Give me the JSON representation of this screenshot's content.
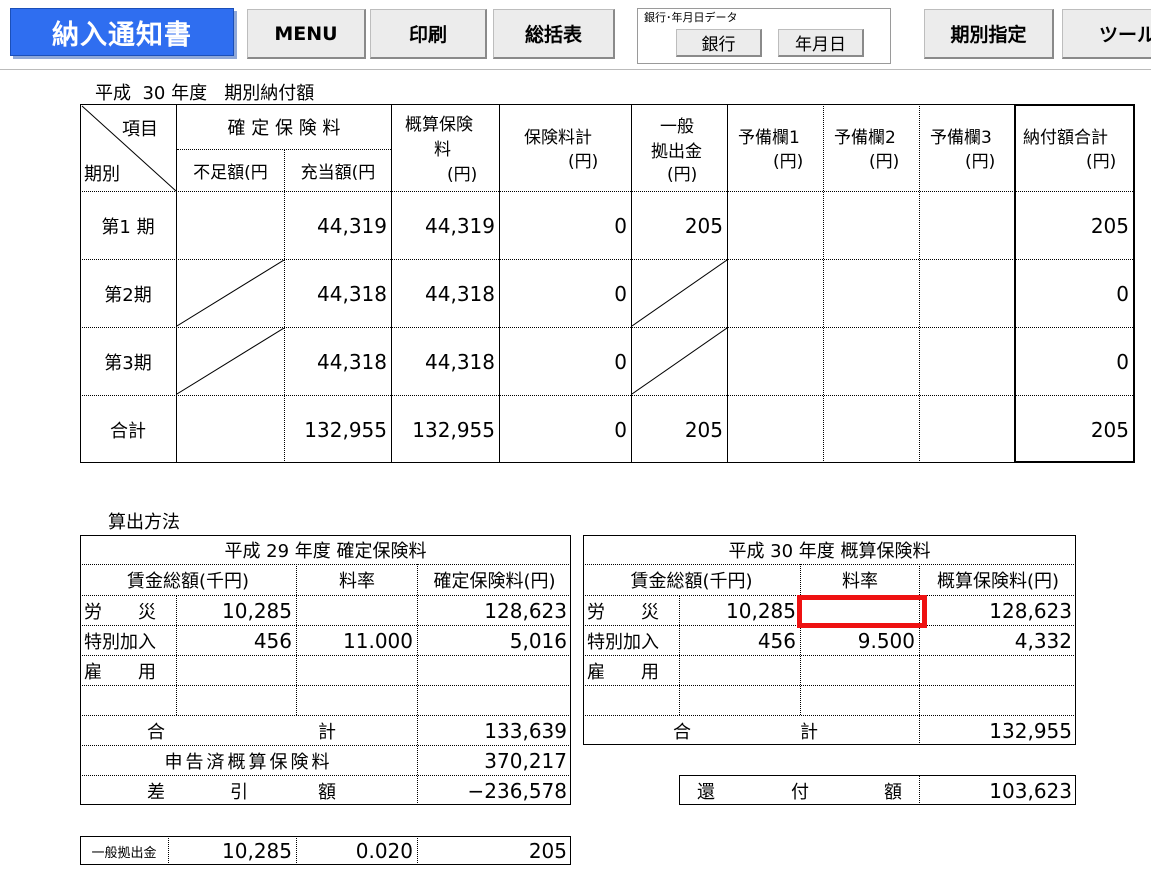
{
  "toolbar": {
    "title": "納入通知書",
    "menu": "MENU",
    "print": "印刷",
    "summary": "総括表",
    "group_label": "銀行･年月日データ",
    "bank": "銀行",
    "date": "年月日",
    "period": "期別指定",
    "tools": "ツール"
  },
  "table1": {
    "title": "平成  30 年度   期別納付額",
    "hdr_item": "項目",
    "hdr_period": "期別",
    "hdr_kakutei": "確 定 保 険 料",
    "hdr_fusoku": "不足額(円",
    "hdr_juto": "充当額(円",
    "hdr_gaisan_1": "概算保険",
    "hdr_gaisan_2": "料",
    "hdr_gaisan_3": "(円)",
    "hdr_hokenkei_1": "保険料計",
    "hdr_hokenkei_2": "(円)",
    "hdr_ippan_1": "一般",
    "hdr_ippan_2": "拠出金",
    "hdr_ippan_3": "(円)",
    "hdr_yobi1_1": "予備欄1",
    "hdr_yobi1_2": "(円)",
    "hdr_yobi2_1": "予備欄2",
    "hdr_yobi2_2": "(円)",
    "hdr_yobi3_1": "予備欄3",
    "hdr_yobi3_2": "(円)",
    "hdr_total_1": "納付額合計",
    "hdr_total_2": "(円)",
    "rows": [
      {
        "label": "第1 期",
        "fusoku": "",
        "juto": "44,319",
        "gaisan": "44,319",
        "hokenkei": "0",
        "ippan": "205",
        "yobi1": "",
        "yobi2": "",
        "yobi3": "",
        "total": "205"
      },
      {
        "label": "第2期",
        "fusoku": "",
        "juto": "44,318",
        "gaisan": "44,318",
        "hokenkei": "0",
        "ippan": "",
        "yobi1": "",
        "yobi2": "",
        "yobi3": "",
        "total": "0"
      },
      {
        "label": "第3期",
        "fusoku": "",
        "juto": "44,318",
        "gaisan": "44,318",
        "hokenkei": "0",
        "ippan": "",
        "yobi1": "",
        "yobi2": "",
        "yobi3": "",
        "total": "0"
      },
      {
        "label": "合計",
        "fusoku": "",
        "juto": "132,955",
        "gaisan": "132,955",
        "hokenkei": "0",
        "ippan": "205",
        "yobi1": "",
        "yobi2": "",
        "yobi3": "",
        "total": "205"
      }
    ]
  },
  "calc": {
    "title": "算出方法",
    "left": {
      "title": "平成  29 年度  確定保険料",
      "hdr_wage": "賃金総額(千円)",
      "hdr_rate": "料率",
      "hdr_premium": "確定保険料(円)",
      "rosai_label": "労　　災",
      "rosai_wage": "10,285",
      "rosai_rate": "",
      "rosai_premium": "128,623",
      "tokubetsu_label": "特別加入",
      "tokubetsu_wage": "456",
      "tokubetsu_rate": "11.000",
      "tokubetsu_premium": "5,016",
      "koyo_label": "雇　　用",
      "total_label_1": "合",
      "total_label_2": "計",
      "total": "133,639",
      "declared_label": "申告済概算保険料",
      "declared": "370,217",
      "diff_label_1": "差",
      "diff_label_2": "引",
      "diff_label_3": "額",
      "diff": "−236,578"
    },
    "right": {
      "title": "平成  30 年度  概算保険料",
      "hdr_wage": "賃金総額(千円)",
      "hdr_rate": "料率",
      "hdr_premium": "概算保険料(円)",
      "rosai_label": "労　　災",
      "rosai_wage": "10,285",
      "rosai_rate": "",
      "rosai_premium": "128,623",
      "tokubetsu_label": "特別加入",
      "tokubetsu_wage": "456",
      "tokubetsu_rate": "9.500",
      "tokubetsu_premium": "4,332",
      "koyo_label": "雇　　用",
      "total_label_1": "合",
      "total_label_2": "計",
      "total": "132,955",
      "refund_label_1": "還",
      "refund_label_2": "付",
      "refund_label_3": "額",
      "refund": "103,623"
    },
    "ippan": {
      "label": "一般拠出金",
      "wage": "10,285",
      "rate": "0.020",
      "amount": "205"
    }
  }
}
